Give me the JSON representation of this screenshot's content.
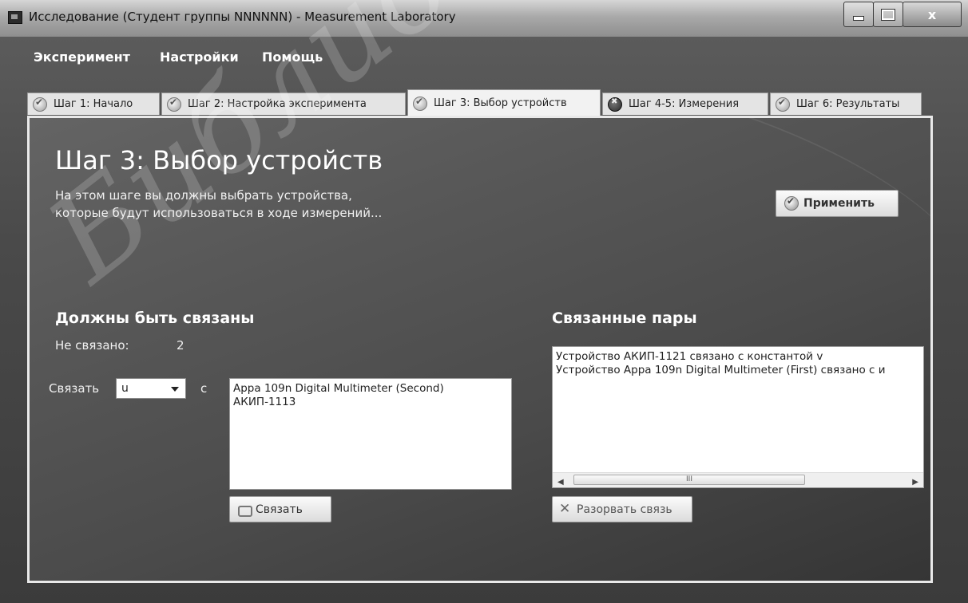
{
  "window": {
    "title": "Исследование (Студент группы NNNNNN) - Measurement Laboratory",
    "close_glyph": "x"
  },
  "menu": [
    "Эксперимент",
    "Настройки",
    "Помощь"
  ],
  "tabs": [
    {
      "label": "Шаг 1: Начало",
      "icon": "check-circle-icon"
    },
    {
      "label": "Шаг 2: Настройка эксперимента",
      "icon": "check-circle-icon"
    },
    {
      "label": "Шаг 3: Выбор устройств",
      "icon": "check-circle-icon",
      "active": true
    },
    {
      "label": "Шаг 4-5: Измерения",
      "icon": "error-circle-icon"
    },
    {
      "label": "Шаг 6: Результаты",
      "icon": "check-circle-icon"
    }
  ],
  "step": {
    "title": "Шаг 3: Выбор устройств",
    "description": "На этом шаге вы должны выбрать устройства,\nкоторые будут использоваться в ходе измерений..."
  },
  "apply_button": "Применить",
  "must_link": {
    "title": "Должны быть связаны",
    "unlinked_label": "Не связано:",
    "unlinked_count": "2",
    "link_label": "Связать",
    "selected_variable": "u",
    "with_label": "с",
    "devices": [
      "Appa 109n Digital Multimeter (Second)",
      "АКИП-1113"
    ],
    "link_button": "Связать"
  },
  "linked_pairs": {
    "title": "Связанные пары",
    "items": [
      "Устройство АКИП-1121 связано с константой v",
      "Устройство Appa 109n Digital Multimeter (First) связано с и"
    ],
    "scroll_thumb": "III",
    "unlink_button": "Разорвать связь"
  },
  "watermark": "Библиотека"
}
